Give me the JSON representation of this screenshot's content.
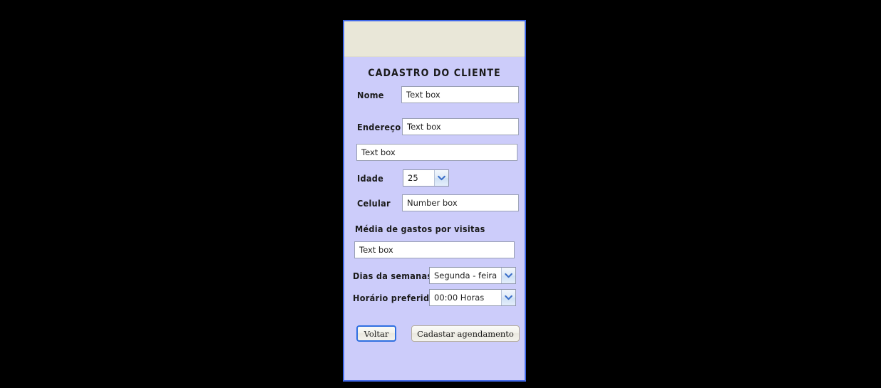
{
  "window": {
    "panel_background": "#ccccfa",
    "header_background": "#e9e7d8",
    "border_color": "#4169e8"
  },
  "form": {
    "title": "CADASTRO DO CLIENTE",
    "fields": {
      "nome": {
        "label": "Nome",
        "placeholder": "Text box",
        "value": "Text box"
      },
      "endereco": {
        "label": "Endereço",
        "placeholder": "Text box",
        "value": "Text box"
      },
      "endereco_linha2": {
        "label": "",
        "placeholder": "Text box",
        "value": "Text box"
      },
      "idade": {
        "label": "Idade",
        "selected": "25"
      },
      "celular": {
        "label": "Celular",
        "placeholder": "Number box",
        "value": "Number box"
      },
      "media_gastos": {
        "label": "Média de gastos por visitas",
        "placeholder": "Text box",
        "value": "Text box"
      },
      "dias_semana": {
        "label": "Dias da semanas",
        "selected": "Segunda - feira"
      },
      "horario": {
        "label": "Horário preferido",
        "selected": "00:00 Horas"
      }
    },
    "buttons": {
      "back": {
        "label": "Voltar",
        "focused": true,
        "focus_color": "#2f6fe0"
      },
      "submit": {
        "label": "Cadastar agendamento",
        "focused": false,
        "border_color": "#b5ad9c"
      }
    },
    "icons": {
      "dropdown_chevron": "chevron-down-icon",
      "chevron_color": "#3b6fc9"
    }
  }
}
